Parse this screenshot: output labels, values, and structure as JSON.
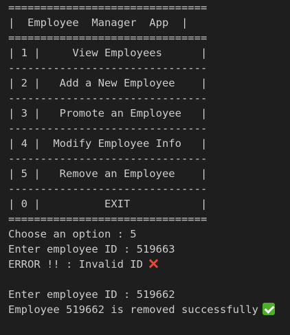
{
  "menu": {
    "border_top": "===============================",
    "title_line": "|  Employee  Manager  App  |",
    "border_after_title": "===============================",
    "items": [
      {
        "line": "| 1 |     View Employees      |"
      },
      {
        "line": "| 2 |   Add a New Employee    |"
      },
      {
        "line": "| 3 |   Promote an Employee   |"
      },
      {
        "line": "| 4 |  Modify Employee Info   |"
      },
      {
        "line": "| 5 |   Remove an Employee    |"
      },
      {
        "line": "| 0 |          EXIT           |"
      }
    ],
    "separator": "-------------------------------",
    "border_bottom": "==============================="
  },
  "output": {
    "choose_prompt": "Choose an option : 5",
    "enter_id_1": "Enter employee ID : 519663",
    "error_line": "ERROR !! : Invalid ID",
    "error_icon": "cross-mark-icon",
    "enter_id_2": "Enter employee ID : 519662",
    "success_line": "Employee 519662 is removed successfully",
    "success_icon": "check-mark-icon"
  },
  "colors": {
    "background": "#1e1e1e",
    "text": "#cccccc",
    "error_icon": "#e8453c",
    "success_icon": "#4caf27"
  }
}
